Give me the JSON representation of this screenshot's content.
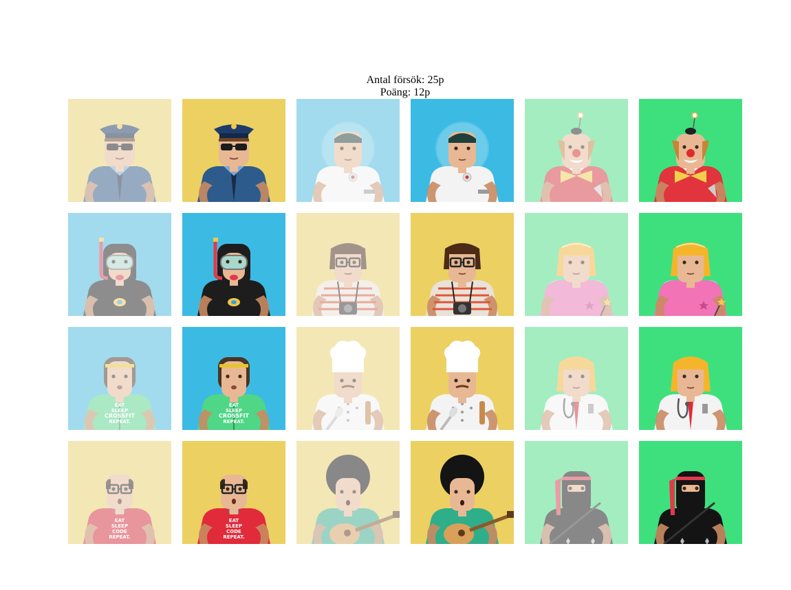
{
  "stats": {
    "attempts_label": "Antal försök: 25p",
    "score_label": "Poäng: 12p"
  },
  "colors": {
    "yellow": "#ecd062",
    "blue": "#3bbbe3",
    "green": "#3ee07e"
  },
  "cards": [
    {
      "character": "police",
      "bg": "yellow",
      "matched": true
    },
    {
      "character": "police",
      "bg": "yellow",
      "matched": false
    },
    {
      "character": "astronaut",
      "bg": "blue",
      "matched": true
    },
    {
      "character": "astronaut",
      "bg": "blue",
      "matched": false
    },
    {
      "character": "clown",
      "bg": "green",
      "matched": true
    },
    {
      "character": "clown",
      "bg": "green",
      "matched": false
    },
    {
      "character": "diver",
      "bg": "blue",
      "matched": true
    },
    {
      "character": "diver",
      "bg": "blue",
      "matched": false
    },
    {
      "character": "photographer",
      "bg": "yellow",
      "matched": true
    },
    {
      "character": "photographer",
      "bg": "yellow",
      "matched": false
    },
    {
      "character": "fairy",
      "bg": "green",
      "matched": true
    },
    {
      "character": "fairy",
      "bg": "green",
      "matched": false
    },
    {
      "character": "crossfit-guy",
      "bg": "blue",
      "matched": true,
      "shirt_text": [
        "EAT",
        "SLEEP",
        "CROSSFIT",
        "REPEAT."
      ]
    },
    {
      "character": "crossfit-guy",
      "bg": "blue",
      "matched": false,
      "shirt_text": [
        "EAT",
        "SLEEP",
        "CROSSFIT",
        "REPEAT."
      ]
    },
    {
      "character": "chef",
      "bg": "yellow",
      "matched": true
    },
    {
      "character": "chef",
      "bg": "yellow",
      "matched": false
    },
    {
      "character": "doctor",
      "bg": "green",
      "matched": true
    },
    {
      "character": "doctor",
      "bg": "green",
      "matched": false
    },
    {
      "character": "coder",
      "bg": "yellow",
      "matched": true,
      "shirt_text": [
        "EAT",
        "SLEEP",
        "CODE",
        "REPEAT."
      ]
    },
    {
      "character": "coder",
      "bg": "yellow",
      "matched": false,
      "shirt_text": [
        "EAT",
        "SLEEP",
        "CODE",
        "REPEAT."
      ]
    },
    {
      "character": "guitarist",
      "bg": "yellow",
      "matched": true
    },
    {
      "character": "guitarist",
      "bg": "yellow",
      "matched": false
    },
    {
      "character": "ninja",
      "bg": "green",
      "matched": true
    },
    {
      "character": "ninja",
      "bg": "green",
      "matched": false
    }
  ]
}
